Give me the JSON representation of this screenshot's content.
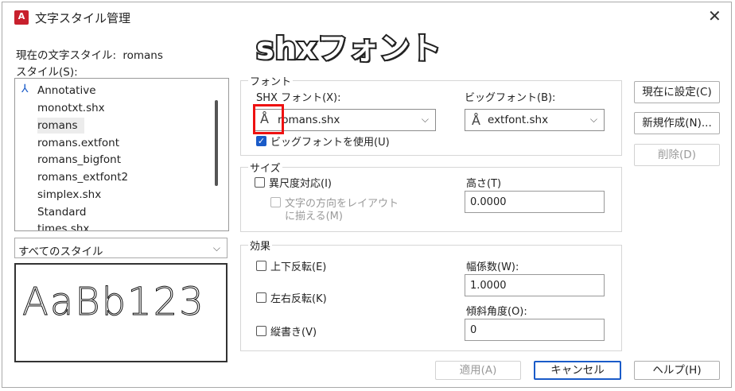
{
  "window": {
    "title": "文字スタイル管理",
    "app_icon": "autocad-icon",
    "close_glyph": "✕"
  },
  "overlay": {
    "text": "shxフォント"
  },
  "current_style": {
    "label": "現在の文字スタイル:",
    "value": "romans"
  },
  "styles": {
    "label": "スタイル(S):",
    "items": [
      "Annotative",
      "monotxt.shx",
      "romans",
      "romans.extfont",
      "romans_bigfont",
      "romans_extfont2",
      "simplex.shx",
      "Standard",
      "times.shx"
    ],
    "selected": "romans",
    "annotative_icon": "annotative-icon"
  },
  "filter": {
    "value": "すべてのスタイル"
  },
  "preview": {
    "text": "AaBb123"
  },
  "font": {
    "group_label": "フォント",
    "shx_label": "SHX フォント(X):",
    "shx_value": "romans.shx",
    "bigfont_label": "ビッグフォント(B):",
    "bigfont_value": "extfont.shx",
    "use_bigfont_label": "ビッグフォントを使用(U)",
    "use_bigfont_checked": true,
    "font_icon": "shx-font-icon"
  },
  "size": {
    "group_label": "サイズ",
    "annotative_label": "異尺度対応(I)",
    "orientation_label_1": "文字の方向をレイアウト",
    "orientation_label_2": "に揃える(M)",
    "height_label": "高さ(T)",
    "height_value": "0.0000"
  },
  "effects": {
    "group_label": "効果",
    "upside_down": "上下反転(E)",
    "backwards": "左右反転(K)",
    "vertical": "縦書き(V)",
    "width_label": "幅係数(W):",
    "width_value": "1.0000",
    "oblique_label": "傾斜角度(O):",
    "oblique_value": "0"
  },
  "buttons": {
    "set_current": "現在に設定(C)",
    "new": "新規作成(N)...",
    "delete": "削除(D)",
    "apply": "適用(A)",
    "cancel": "キャンセル",
    "help": "ヘルプ(H)"
  }
}
